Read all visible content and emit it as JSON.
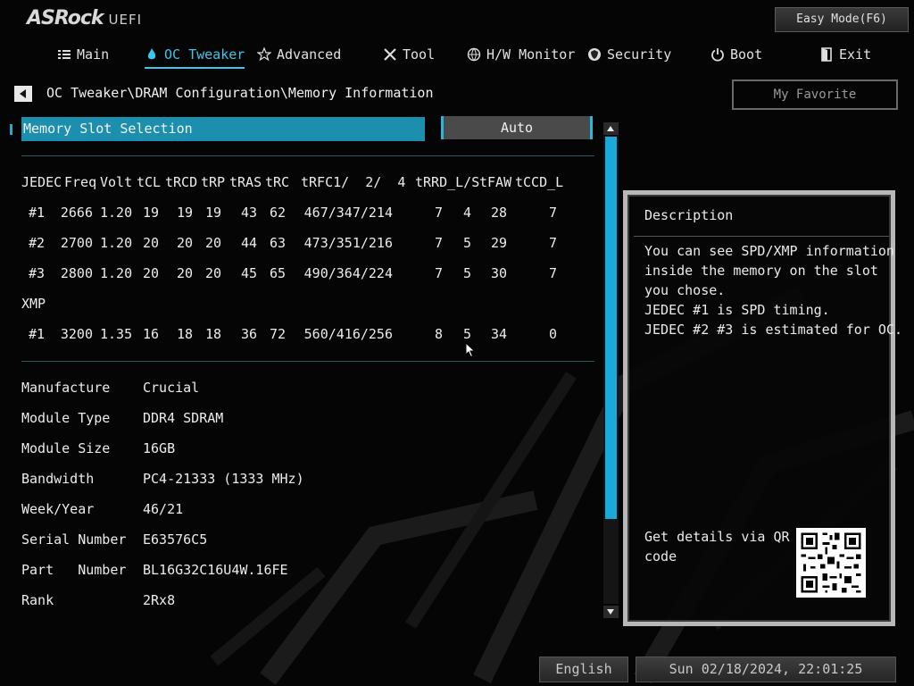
{
  "header": {
    "logo_main": "ASRock",
    "logo_sub": "UEFI",
    "easy_mode_label": "Easy Mode(F6)"
  },
  "nav": {
    "items": [
      {
        "label": "Main",
        "icon": "list-icon"
      },
      {
        "label": "OC Tweaker",
        "icon": "flame-icon",
        "active": true
      },
      {
        "label": "Advanced",
        "icon": "star-icon"
      },
      {
        "label": "Tool",
        "icon": "tools-icon"
      },
      {
        "label": "H/W Monitor",
        "icon": "globe-icon"
      },
      {
        "label": "Security",
        "icon": "shield-icon"
      },
      {
        "label": "Boot",
        "icon": "power-icon"
      },
      {
        "label": "Exit",
        "icon": "exit-icon"
      }
    ]
  },
  "breadcrumb": "OC Tweaker\\DRAM Configuration\\Memory Information",
  "favorite_label": "My Favorite",
  "slot_selection": {
    "label": "Memory Slot Selection",
    "value": "Auto"
  },
  "timings": {
    "headers": [
      "JEDEC",
      "Freq",
      "Volt",
      "tCL",
      "tRCD",
      "tRP",
      "tRAS",
      "tRC",
      "tRFC1/  2/  4",
      "tRRD_L/S",
      "tFAW",
      "tCCD_L"
    ],
    "jedec_rows": [
      {
        "id": "#1",
        "freq": "2666",
        "volt": "1.20",
        "tcl": "19",
        "trcd": "19",
        "trp": "19",
        "tras": "43",
        "trc": "62",
        "trfc": "467/347/214",
        "trrd_l": "7",
        "trrd_s": "4",
        "tfaw": "28",
        "tccd_l": "7"
      },
      {
        "id": "#2",
        "freq": "2700",
        "volt": "1.20",
        "tcl": "20",
        "trcd": "20",
        "trp": "20",
        "tras": "44",
        "trc": "63",
        "trfc": "473/351/216",
        "trrd_l": "7",
        "trrd_s": "5",
        "tfaw": "29",
        "tccd_l": "7"
      },
      {
        "id": "#3",
        "freq": "2800",
        "volt": "1.20",
        "tcl": "20",
        "trcd": "20",
        "trp": "20",
        "tras": "45",
        "trc": "65",
        "trfc": "490/364/224",
        "trrd_l": "7",
        "trrd_s": "5",
        "tfaw": "30",
        "tccd_l": "7"
      }
    ],
    "xmp_label": "XMP",
    "xmp_rows": [
      {
        "id": "#1",
        "freq": "3200",
        "volt": "1.35",
        "tcl": "16",
        "trcd": "18",
        "trp": "18",
        "tras": "36",
        "trc": "72",
        "trfc": "560/416/256",
        "trrd_l": "8",
        "trrd_s": "5",
        "tfaw": "34",
        "tccd_l": "0"
      }
    ]
  },
  "module_info": [
    {
      "label": "Manufacture",
      "value": "Crucial"
    },
    {
      "label": "Module Type",
      "value": "DDR4 SDRAM"
    },
    {
      "label": "Module Size",
      "value": "16GB"
    },
    {
      "label": "Bandwidth",
      "value": "PC4-21333 (1333 MHz)"
    },
    {
      "label": "Week/Year",
      "value": "46/21"
    },
    {
      "label": "Serial Number",
      "value": "E63576C5"
    },
    {
      "label": "Part   Number",
      "value": "BL16G32C16U4W.16FE"
    },
    {
      "label": "Rank",
      "value": "2Rx8"
    }
  ],
  "description": {
    "title": "Description",
    "lines": [
      "You can see SPD/XMP information",
      "inside the memory on the slot",
      "you chose.",
      "JEDEC #1 is SPD timing.",
      "JEDEC #2 #3 is estimated for OC."
    ],
    "qr_lines": [
      "Get details via QR",
      "code"
    ]
  },
  "footer": {
    "language": "English",
    "datetime": "Sun 02/18/2024, 22:01:25"
  },
  "colors": {
    "accent": "#1c8fae",
    "active_tab": "#3cc6ea",
    "scroll_thumb": "#1aa9d8",
    "background": "#050505"
  }
}
